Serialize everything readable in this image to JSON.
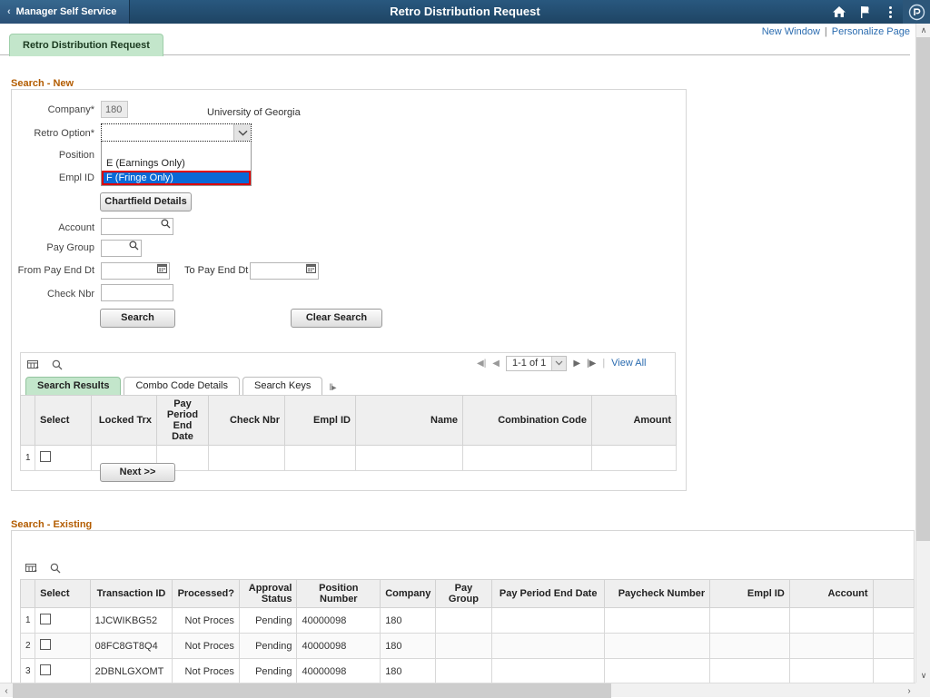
{
  "navbar": {
    "breadcrumb_label": "Manager Self Service",
    "back_chevron": "‹",
    "title": "Retro Distribution Request",
    "icons": {
      "home": "home-icon",
      "flag": "flag-icon",
      "actions": "three-dots-icon",
      "navbar": "nav-compass-icon"
    }
  },
  "page_links": {
    "new_window": "New Window",
    "separator": "|",
    "personalize": "Personalize Page"
  },
  "page_tab": {
    "label": "Retro Distribution Request"
  },
  "search_new": {
    "title": "Search - New",
    "fields": {
      "company_label": "Company*",
      "company_value": "180",
      "company_desc": "University of Georgia",
      "retro_option_label": "Retro Option*",
      "retro_option_value": "",
      "position_label": "Position",
      "position_value": "",
      "empl_id_label": "Empl ID",
      "empl_id_value": "",
      "account_label": "Account",
      "account_value": "",
      "pay_group_label": "Pay Group",
      "pay_group_value": "",
      "from_pay_end_dt_label": "From Pay End Dt",
      "from_pay_end_dt_value": "",
      "to_pay_end_dt_label": "To Pay End Dt",
      "to_pay_end_dt_value": "",
      "check_nbr_label": "Check Nbr",
      "check_nbr_value": ""
    },
    "retro_option_dropdown": {
      "open": true,
      "options": [
        {
          "label": "",
          "selected": false
        },
        {
          "label": "E (Earnings Only)",
          "selected": false
        },
        {
          "label": "F (Fringe Only)",
          "selected": true
        }
      ],
      "highlight_color": "#0a69d6",
      "focus_outline_color": "#e00000"
    },
    "buttons": {
      "chartfield_details": "Chartfield Details",
      "search": "Search",
      "clear_search": "Clear Search",
      "next": "Next >>"
    }
  },
  "results_grid": {
    "toolbar": {
      "personalize_icon": "grid-personalize-icon",
      "find_icon": "search-icon"
    },
    "tabs": [
      {
        "label": "Search Results",
        "active": true
      },
      {
        "label": "Combo Code Details",
        "active": false
      },
      {
        "label": "Search Keys",
        "active": false
      }
    ],
    "tab_overflow": "‖▸",
    "pager": {
      "first": "◀|",
      "prev": "◀",
      "range": "1-1 of 1",
      "next": "▶",
      "last": "|▶",
      "view_all": "View All"
    },
    "columns": [
      "Select",
      "Locked Trx",
      "Pay Period End Date",
      "Check Nbr",
      "Empl ID",
      "Name",
      "Combination Code",
      "Amount"
    ],
    "rows": [
      {
        "num": "1",
        "selected": false,
        "locked_trx": "",
        "pay_period_end_date": "",
        "check_nbr": "",
        "empl_id": "",
        "name": "",
        "combination_code": "",
        "amount": ""
      }
    ]
  },
  "search_existing": {
    "title": "Search - Existing",
    "toolbar": {
      "personalize_icon": "grid-personalize-icon",
      "find_icon": "search-icon"
    },
    "columns": [
      "Select",
      "Transaction ID",
      "Processed?",
      "Approval Status",
      "Position Number",
      "Company",
      "Pay Group",
      "Pay Period End Date",
      "Paycheck Number",
      "Empl ID",
      "Account"
    ],
    "rows": [
      {
        "num": "1",
        "selected": false,
        "transaction_id": "1JCWIKBG52",
        "processed": "Not Proces",
        "approval_status": "Pending",
        "position_number": "40000098",
        "company": "180",
        "pay_group": "",
        "pay_period_end_date": "",
        "paycheck_number": "",
        "empl_id": "",
        "account": ""
      },
      {
        "num": "2",
        "selected": false,
        "transaction_id": "08FC8GT8Q4",
        "processed": "Not Proces",
        "approval_status": "Pending",
        "position_number": "40000098",
        "company": "180",
        "pay_group": "",
        "pay_period_end_date": "",
        "paycheck_number": "",
        "empl_id": "",
        "account": ""
      },
      {
        "num": "3",
        "selected": false,
        "transaction_id": "2DBNLGXOMT",
        "processed": "Not Proces",
        "approval_status": "Pending",
        "position_number": "40000098",
        "company": "180",
        "pay_group": "",
        "pay_period_end_date": "",
        "paycheck_number": "",
        "empl_id": "",
        "account": ""
      }
    ]
  },
  "scrollbars": {
    "vertical_up": "∧",
    "vertical_down": "∨",
    "horizontal_left": "‹",
    "horizontal_right": "›"
  },
  "colors": {
    "navbar": "#29587f",
    "tab_active": "#c3e6cb",
    "section_title": "#b35c00",
    "link": "#2b6cb0"
  }
}
